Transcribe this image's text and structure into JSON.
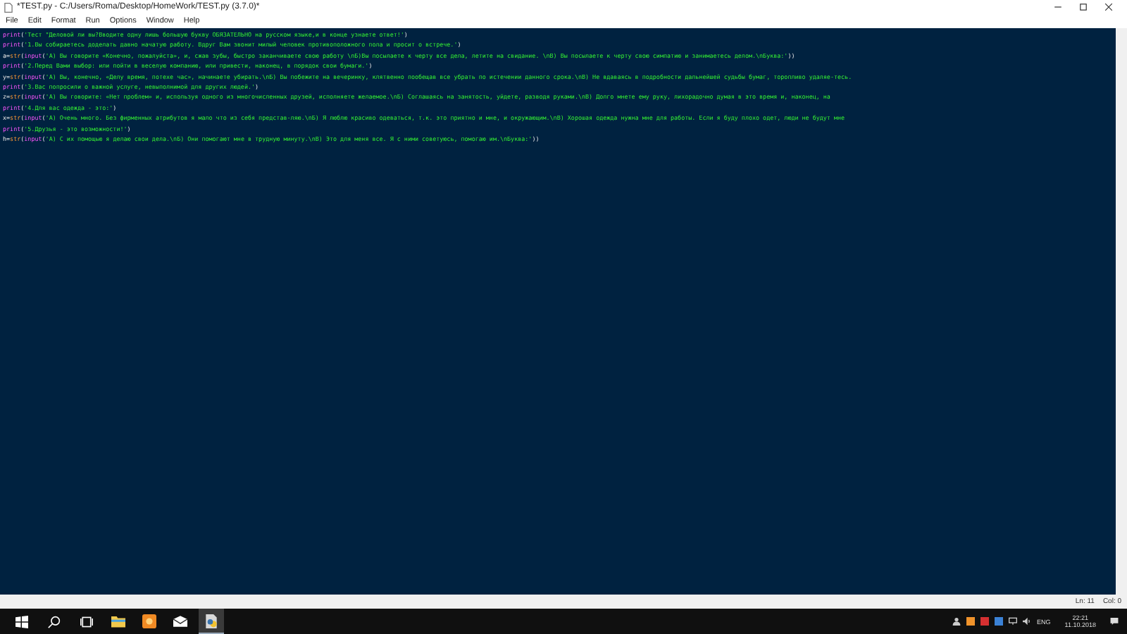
{
  "window": {
    "title": "*TEST.py - C:/Users/Roma/Desktop/HomeWork/TEST.py (3.7.0)*"
  },
  "menu": [
    "File",
    "Edit",
    "Format",
    "Run",
    "Options",
    "Window",
    "Help"
  ],
  "code": [
    [
      {
        "kind": "keyword",
        "text": "print"
      },
      {
        "kind": "plain",
        "text": "("
      },
      {
        "kind": "string",
        "text": "'Тест \"Деловой ли вы?Вводите одну лишь большую букву ОБЯЗАТЕЛЬНО на русском языке,и в конце узнаете ответ!'"
      },
      {
        "kind": "plain",
        "text": ")"
      }
    ],
    [
      {
        "kind": "keyword",
        "text": "print"
      },
      {
        "kind": "plain",
        "text": "("
      },
      {
        "kind": "string",
        "text": "'1.Вы собираетесь доделать давно начатую работу. Вдруг Вам звонит милый человек противоположного пола и просит о встрече.'"
      },
      {
        "kind": "plain",
        "text": ")"
      }
    ],
    [
      {
        "kind": "plain",
        "text": "a="
      },
      {
        "kind": "builtin",
        "text": "str"
      },
      {
        "kind": "plain",
        "text": "("
      },
      {
        "kind": "keyword",
        "text": "input"
      },
      {
        "kind": "plain",
        "text": "("
      },
      {
        "kind": "string",
        "text": "'А) Вы говорите «Конечно, пожалуйста», и, сжав зубы, быстро заканчиваете свою работу \\nБ)Вы посылаете к черту все дела, летите на свидание. \\nВ) Вы посылаете к черту свою симпатию и занимаетесь делом.\\nБуква:'"
      },
      {
        "kind": "plain",
        "text": "))"
      }
    ],
    [
      {
        "kind": "keyword",
        "text": "print"
      },
      {
        "kind": "plain",
        "text": "("
      },
      {
        "kind": "string",
        "text": "'2.Перед Вами выбор: или пойти в веселую компанию, или привести, наконец, в порядок свои бумаги.'"
      },
      {
        "kind": "plain",
        "text": ")"
      }
    ],
    [
      {
        "kind": "plain",
        "text": "y="
      },
      {
        "kind": "builtin",
        "text": "str"
      },
      {
        "kind": "plain",
        "text": "("
      },
      {
        "kind": "keyword",
        "text": "input"
      },
      {
        "kind": "plain",
        "text": "("
      },
      {
        "kind": "string",
        "text": "'А) Вы, конечно, «Делу время, потехе час», начинаете убирать.\\nБ) Вы побежите на вечеринку, клятвенно пообещав все убрать по истечении данного срока.\\nВ) Не вдаваясь в подробности дальнейшей судьбы бумаг, торопливо удаляе-тесь."
      }
    ],
    [
      {
        "kind": "keyword",
        "text": "print"
      },
      {
        "kind": "plain",
        "text": "("
      },
      {
        "kind": "string",
        "text": "'3.Вас попросили о важной услуге, невыполнимой для других людей.'"
      },
      {
        "kind": "plain",
        "text": ")"
      }
    ],
    [
      {
        "kind": "plain",
        "text": "z="
      },
      {
        "kind": "builtin",
        "text": "str"
      },
      {
        "kind": "plain",
        "text": "("
      },
      {
        "kind": "keyword",
        "text": "input"
      },
      {
        "kind": "plain",
        "text": "("
      },
      {
        "kind": "string",
        "text": "'А) Вы говорите: «Нет проблем» и, используя одного из многочисленных друзей, исполняете желаемое.\\nБ) Соглашаясь на занятость, уйдете, разводя руками.\\nВ) Долго мнете ему руку, лихорадочно думая в это время и, наконец, на"
      }
    ],
    [
      {
        "kind": "keyword",
        "text": "print"
      },
      {
        "kind": "plain",
        "text": "("
      },
      {
        "kind": "string",
        "text": "'4.Для вас одежда - это:'"
      },
      {
        "kind": "plain",
        "text": ")"
      }
    ],
    [
      {
        "kind": "plain",
        "text": "x="
      },
      {
        "kind": "builtin",
        "text": "str"
      },
      {
        "kind": "plain",
        "text": "("
      },
      {
        "kind": "keyword",
        "text": "input"
      },
      {
        "kind": "plain",
        "text": "("
      },
      {
        "kind": "string",
        "text": "'А) Очень много. Без фирменных атрибутов я мало что из себя представ-ляю.\\nБ) Я люблю красиво одеваться, т.к. это приятно и мне, и окружающим.\\nВ) Хорошая одежда нужна мне для работы. Если я буду плохо одет, люди не будут мне"
      }
    ],
    [
      {
        "kind": "keyword",
        "text": "print"
      },
      {
        "kind": "plain",
        "text": "("
      },
      {
        "kind": "string",
        "text": "'5.Друзья - это возможности!'"
      },
      {
        "kind": "plain",
        "text": ")"
      }
    ],
    [
      {
        "kind": "plain",
        "text": "h="
      },
      {
        "kind": "builtin",
        "text": "str"
      },
      {
        "kind": "plain",
        "text": "("
      },
      {
        "kind": "keyword",
        "text": "input"
      },
      {
        "kind": "plain",
        "text": "("
      },
      {
        "kind": "string",
        "text": "'А) С их помощью я делаю свои дела.\\nБ) Они помогают мне в трудную минуту.\\nВ) Это для меня все. Я с ними советуюсь, помогаю им.\\nБуква:'"
      },
      {
        "kind": "plain",
        "text": "))"
      }
    ]
  ],
  "status": {
    "line": "Ln: 11",
    "col": "Col: 0"
  },
  "taskbar": {
    "apps": [
      {
        "kind": "folder",
        "selected": false
      },
      {
        "kind": "orange",
        "selected": false
      },
      {
        "kind": "mail",
        "selected": false
      },
      {
        "kind": "python",
        "selected": true
      }
    ],
    "language": "ENG",
    "time": "22:21",
    "date": "11.10.2018"
  }
}
